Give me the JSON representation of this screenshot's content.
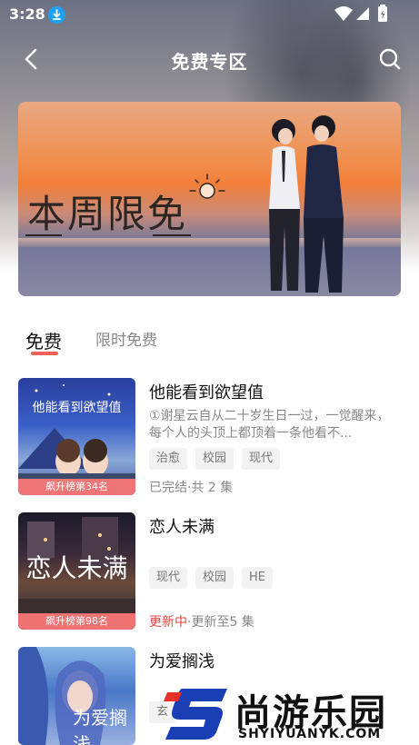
{
  "status_bar": {
    "time": "3:28"
  },
  "header": {
    "title": "免费专区"
  },
  "banner": {
    "title": "本周限免"
  },
  "tabs": [
    {
      "label": "免费",
      "active": true
    },
    {
      "label": "限时免费",
      "active": false
    }
  ],
  "items": [
    {
      "title": "他能看到欲望值",
      "description": "①谢星云自从二十岁生日一过，一觉醒来，每个人的头顶上都顶着一条他看不...",
      "tags": [
        "治愈",
        "校园",
        "现代"
      ],
      "status": "已完结·共 2 集",
      "rank_badge": "飙升榜第34名",
      "cover_text": "他能看到欲望值"
    },
    {
      "title": "恋人未满",
      "description": "",
      "tags": [
        "现代",
        "校园",
        "HE"
      ],
      "status_highlight": "更新中",
      "status": "·更新至5 集",
      "rank_badge": "飙升榜第98名",
      "cover_text": "恋人未满"
    },
    {
      "title": "为爱搁浅",
      "description": "",
      "tags": [
        "玄"
      ],
      "status": "",
      "rank_badge": "",
      "cover_text": "为爱搁浅"
    }
  ],
  "watermark": {
    "text": "尚游乐园",
    "sub": "SHYIYUANYK.COM"
  },
  "colors": {
    "accent": "#f0605a",
    "updating": "#ee4444",
    "badge": "#ff7878"
  }
}
